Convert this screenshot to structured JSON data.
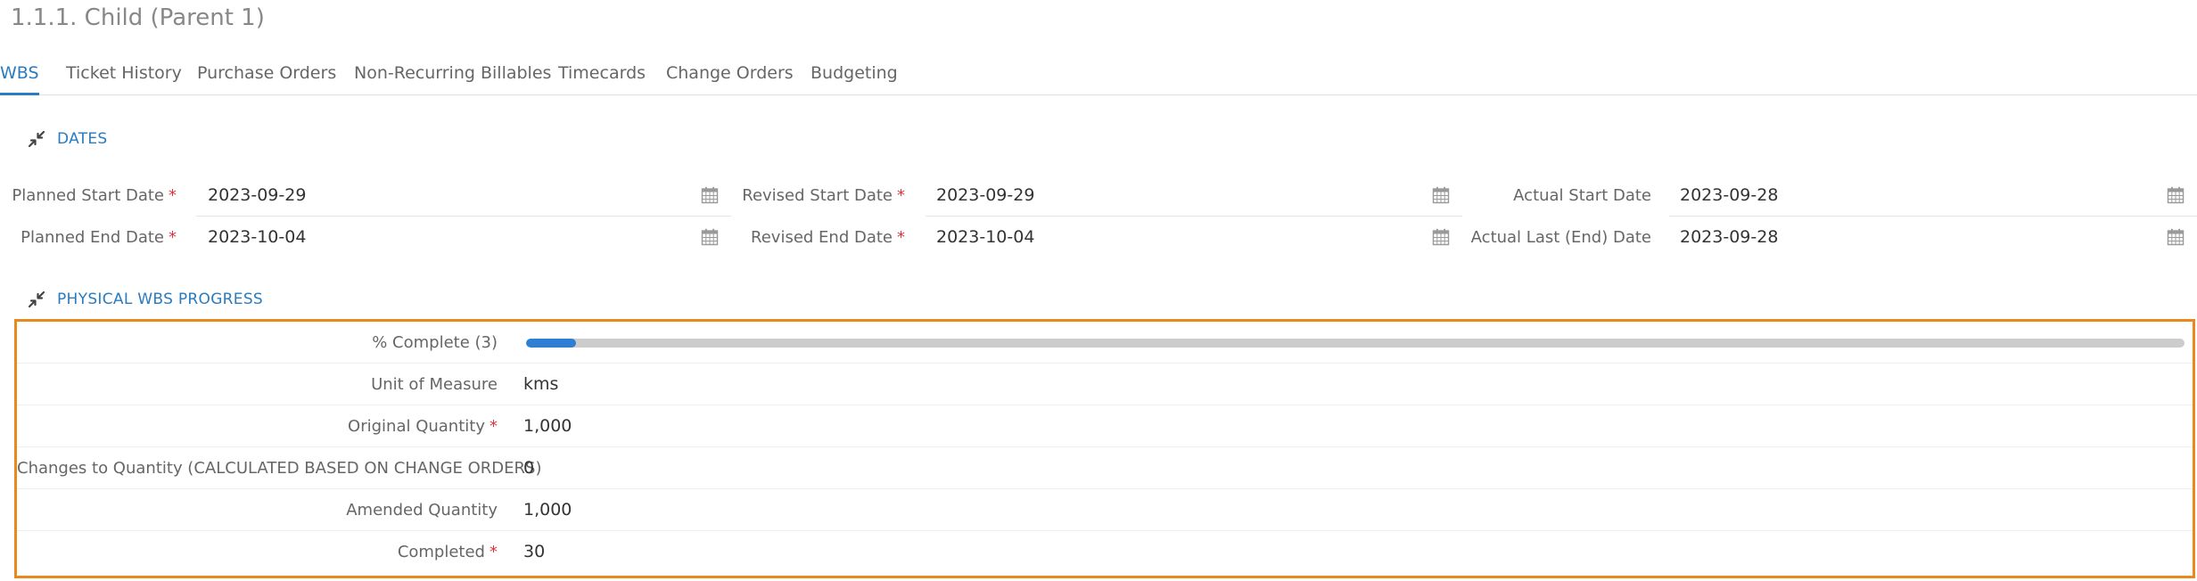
{
  "page": {
    "title": "1.1.1. Child (Parent 1)"
  },
  "tabs": [
    {
      "label": "WBS",
      "active": true
    },
    {
      "label": "Ticket History"
    },
    {
      "label": "Purchase Orders"
    },
    {
      "label": "Non-Recurring Billables"
    },
    {
      "label": "Timecards"
    },
    {
      "label": "Change Orders"
    },
    {
      "label": "Budgeting"
    }
  ],
  "dates_section": {
    "title": "DATES",
    "icon": "collapse-arrows-icon",
    "rows": [
      [
        {
          "label": "Planned Start Date",
          "required": "*",
          "value": "2023-09-29",
          "icon": "calendar-icon"
        },
        {
          "label": "Revised Start Date",
          "required": "*",
          "value": "2023-09-29",
          "icon": "calendar-icon"
        },
        {
          "label": "Actual Start Date",
          "required": "",
          "value": "2023-09-28",
          "icon": "calendar-icon"
        }
      ],
      [
        {
          "label": "Planned End Date",
          "required": "*",
          "value": "2023-10-04",
          "icon": "calendar-icon"
        },
        {
          "label": "Revised End Date",
          "required": "*",
          "value": "2023-10-04",
          "icon": "calendar-icon"
        },
        {
          "label": "Actual Last (End) Date",
          "required": "",
          "value": "2023-09-28",
          "icon": "calendar-icon"
        }
      ]
    ]
  },
  "progress_section": {
    "title": "PHYSICAL WBS PROGRESS",
    "icon": "collapse-arrows-icon",
    "percent_complete": {
      "label": "% Complete (3)",
      "value_percent": 3
    },
    "rows": [
      {
        "label": "Unit of Measure",
        "required": "",
        "value": "kms"
      },
      {
        "label": "Original Quantity",
        "required": "*",
        "value": "1,000"
      },
      {
        "label": "Changes to Quantity (CALCULATED BASED ON CHANGE ORDERS)",
        "required": "",
        "value": "0"
      },
      {
        "label": "Amended Quantity",
        "required": "",
        "value": "1,000"
      },
      {
        "label": "Completed",
        "required": "*",
        "value": "30"
      }
    ]
  },
  "colors": {
    "accent": "#2a7bbf",
    "required": "#d9363e",
    "highlight_border": "#e8891c",
    "progress_fill": "#2e7fd4",
    "progress_track": "#cccccc"
  }
}
